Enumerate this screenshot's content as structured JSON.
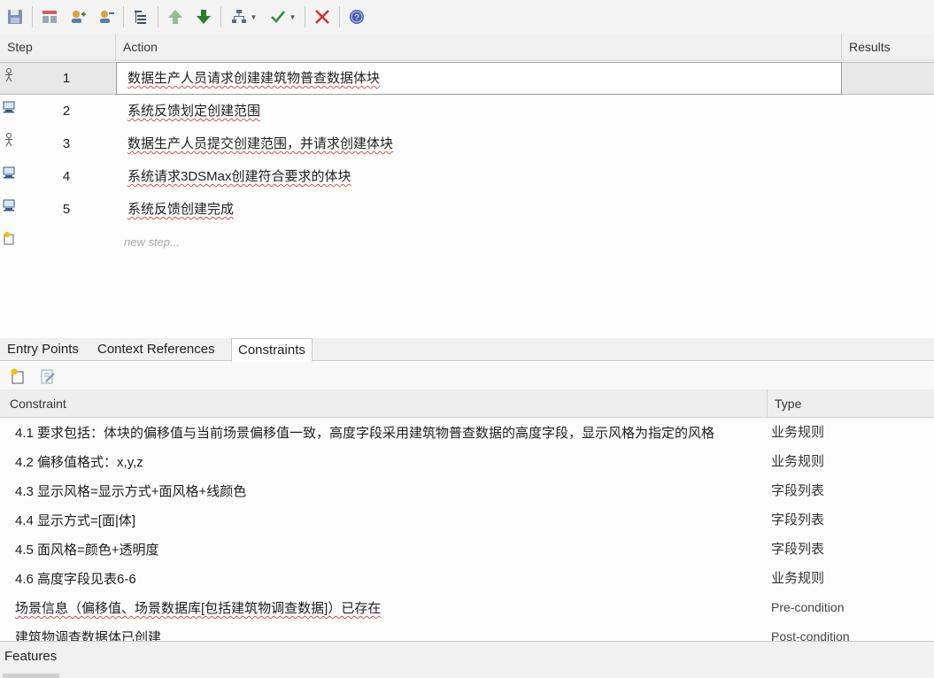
{
  "toolbar": {
    "buttons": [
      "save-icon",
      "insert-row-icon",
      "add-user-icon",
      "edit-user-icon",
      "hierarchy-icon",
      "move-up-icon",
      "move-down-icon",
      "structure-icon",
      "check-icon",
      "delete-icon",
      "help-icon"
    ]
  },
  "steps_grid": {
    "headers": {
      "step": "Step",
      "action": "Action",
      "results": "Results"
    },
    "rows": [
      {
        "num": "1",
        "actor": "actor-icon",
        "action": "数据生产人员请求创建建筑物普查数据体块"
      },
      {
        "num": "2",
        "actor": "system-icon",
        "action": "系统反馈划定创建范围"
      },
      {
        "num": "3",
        "actor": "actor-icon",
        "action": "数据生产人员提交创建范围，并请求创建体块"
      },
      {
        "num": "4",
        "actor": "system-icon",
        "action": "系统请求3DSMax创建符合要求的体块"
      },
      {
        "num": "5",
        "actor": "system-icon",
        "action": "系统反馈创建完成"
      }
    ],
    "new_step": "new step..."
  },
  "tabs": [
    "Entry Points",
    "Context References",
    "Constraints"
  ],
  "constraints": {
    "headers": {
      "constraint": "Constraint",
      "type": "Type"
    },
    "rows": [
      {
        "text": "4.1 要求包括：体块的偏移值与当前场景偏移值一致，高度字段采用建筑物普查数据的高度字段，显示风格为指定的风格",
        "type": "业务规则"
      },
      {
        "text": "4.2 偏移值格式：x,y,z",
        "type": "业务规则"
      },
      {
        "text": "4.3 显示风格=显示方式+面风格+线颜色",
        "type": "字段列表"
      },
      {
        "text": "4.4 显示方式=[面|体]",
        "type": "字段列表"
      },
      {
        "text": "4.5 面风格=颜色+透明度",
        "type": "字段列表"
      },
      {
        "text": "4.6 高度字段见表6-6",
        "type": "业务规则"
      },
      {
        "text": "场景信息（偏移值、场景数据库[包括建筑物调查数据]）已存在",
        "type": "Pre-condition"
      },
      {
        "text": "建筑物调查数据体已创建",
        "type": "Post-condition"
      }
    ]
  },
  "features": {
    "label": "Features"
  }
}
